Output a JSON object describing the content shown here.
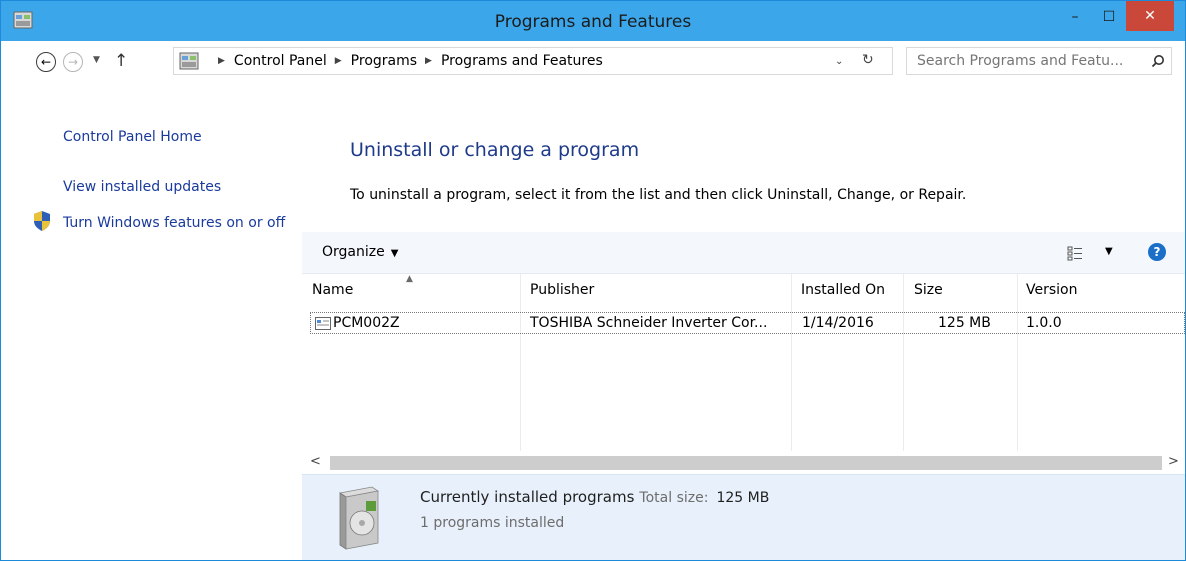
{
  "window": {
    "title": "Programs and Features",
    "min_glyph": "–",
    "max_glyph": "☐",
    "close_glyph": "✕"
  },
  "address": {
    "crumbs": [
      "Control Panel",
      "Programs",
      "Programs and Features"
    ],
    "search_placeholder": "Search Programs and Featu..."
  },
  "leftnav": {
    "home": "Control Panel Home",
    "updates": "View installed updates",
    "features": "Turn Windows features on or off"
  },
  "main": {
    "title": "Uninstall or change a program",
    "description": "To uninstall a program, select it from the list and then click Uninstall, Change, or Repair."
  },
  "toolbar": {
    "organize": "Organize"
  },
  "table": {
    "columns": [
      "Name",
      "Publisher",
      "Installed On",
      "Size",
      "Version"
    ],
    "rows": [
      {
        "name": "PCM002Z",
        "publisher": "TOSHIBA Schneider Inverter Cor...",
        "installed_on": "1/14/2016",
        "size": "125 MB",
        "version": "1.0.0"
      }
    ]
  },
  "details": {
    "title": "Currently installed programs",
    "total_label": "Total size:",
    "total_value": "125 MB",
    "count": "1 programs installed"
  },
  "colors": {
    "titlebar": "#3ba7ea",
    "close": "#c9483a",
    "link": "#1a3a9c",
    "heading": "#1e3a8a",
    "details_bg": "#e8f1fb"
  }
}
